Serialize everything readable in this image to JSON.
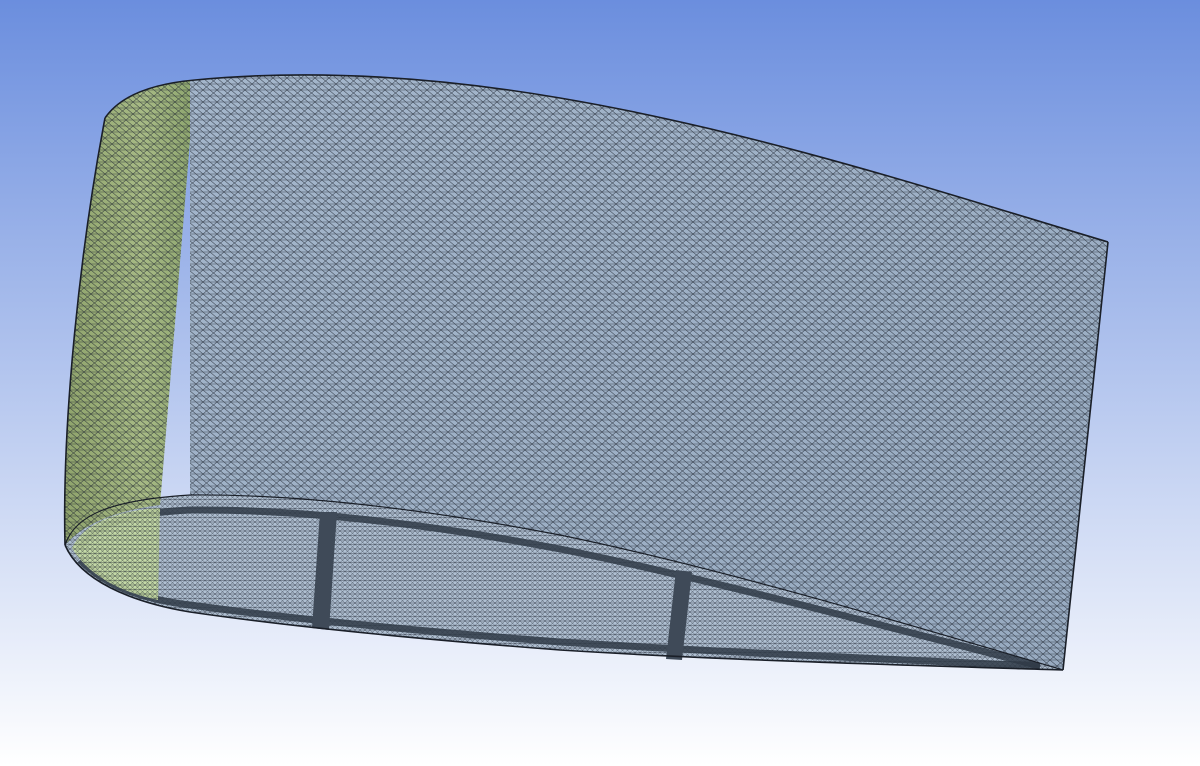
{
  "viewport": {
    "background_top_color": "#6b8ede",
    "background_bottom_color": "#ffffff"
  },
  "model": {
    "part": "wing-section",
    "mesh_element_type": "triangular",
    "mesh_line_color": "#1e2530",
    "upper_surface_color": "#9fb2c8",
    "leading_edge_face_color": "#c6dca2",
    "root_face_color": "#b0c0d2",
    "spar_color": "#3f4a58",
    "spar_count": 2
  }
}
